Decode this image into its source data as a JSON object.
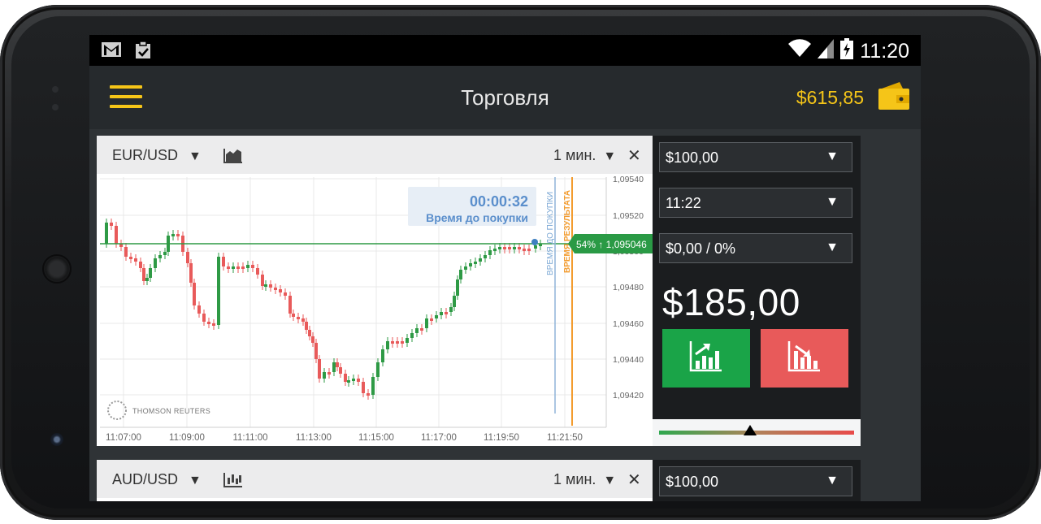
{
  "status": {
    "time": "11:20"
  },
  "app": {
    "title": "Торговля",
    "balance": "$615,85"
  },
  "panel1": {
    "pair": "EUR/USD",
    "timeframe": "1 мин.",
    "countdown": "00:00:32",
    "countdown_label": "Время до покупки",
    "vline_purchase": "ВРЕМЯ ДО ПОКУПКИ",
    "vline_result": "ВРЕМЯ РЕЗУЛЬТАТА",
    "current_price_label": "54% ↑ 1,095046",
    "watermark": "THOMSON REUTERS",
    "y_ticks": [
      "1,09540",
      "1,09520",
      "1,09500",
      "1,09480",
      "1,09460",
      "1,09440",
      "1,09420"
    ],
    "x_ticks": [
      "11:07:00",
      "11:09:00",
      "11:11:00",
      "11:13:00",
      "11:15:00",
      "11:17:00",
      "11:19:50",
      "11:21:50"
    ]
  },
  "side1": {
    "investment": "$100,00",
    "expiry": "11:22",
    "payout_option": "$0,00 / 0%",
    "potential_payout": "$185,00"
  },
  "panel2": {
    "pair": "AUD/USD",
    "timeframe": "1 мин."
  },
  "side2": {
    "investment": "$100,00"
  },
  "colors": {
    "accent": "#f5c518",
    "up": "#1aa448",
    "down": "#e85a5a",
    "price_line": "#2e9a45"
  },
  "icons": [
    "gmail-icon",
    "clipboard-check-icon",
    "wifi-icon",
    "signal-icon",
    "battery-charging-icon",
    "menu-icon",
    "wallet-icon",
    "area-chart-icon",
    "candles-chart-icon",
    "chevron-down-icon",
    "close-icon",
    "chart-up-icon",
    "chart-down-icon",
    "recent-apps-icon",
    "home-icon",
    "back-icon"
  ]
}
